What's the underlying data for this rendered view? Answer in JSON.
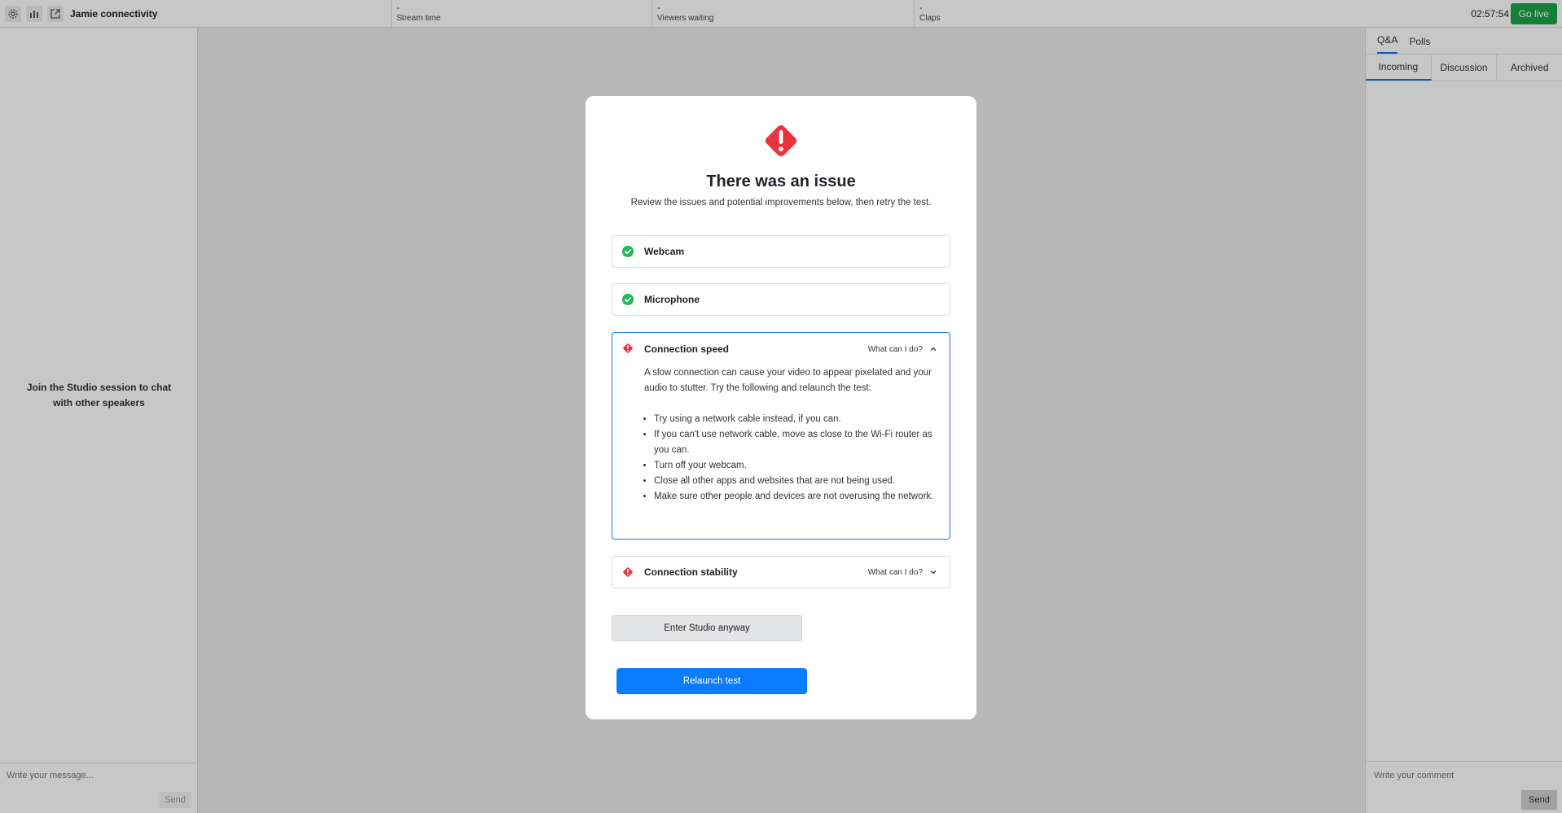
{
  "topbar": {
    "icons": [
      "gear-icon",
      "bar-chart-icon",
      "external-link-icon"
    ],
    "title": "Jamie connectivity",
    "stats": [
      {
        "value": "-",
        "label": "Stream time"
      },
      {
        "value": "-",
        "label": "Viewers waiting"
      },
      {
        "value": "-",
        "label": "Claps"
      }
    ],
    "timer": "02:57:54",
    "go_live_label": "Go live",
    "go_live_color": "#1aa34a"
  },
  "left_chat": {
    "empty_text": "Join the Studio session to chat with other speakers",
    "placeholder": "Write your message...",
    "send_label": "Send"
  },
  "right_panel": {
    "tabs": [
      {
        "label": "Q&A",
        "active": true
      },
      {
        "label": "Polls",
        "active": false
      }
    ],
    "subtabs": [
      {
        "label": "Incoming",
        "active": true
      },
      {
        "label": "Discussion",
        "active": false
      },
      {
        "label": "Archived",
        "active": false
      }
    ],
    "placeholder": "Write your comment",
    "send_label": "Send"
  },
  "modal": {
    "icon": "warning-diamond-icon",
    "title": "There was an issue",
    "subtitle": "Review the issues and potential improvements below, then retry the test.",
    "checks": [
      {
        "name": "Webcam",
        "status": "pass",
        "icon": "check-circle-icon"
      },
      {
        "name": "Microphone",
        "status": "pass",
        "icon": "check-circle-icon"
      },
      {
        "name": "Connection speed",
        "status": "fail",
        "icon": "warning-diamond-icon",
        "help_label": "What can I do?",
        "expanded": true,
        "intro": "A slow connection can cause your video to appear pixelated and your audio to stutter. Try the following and relaunch the test:",
        "tips": [
          "Try using a network cable instead, if you can.",
          "If you can't use network cable, move as close to the Wi-Fi router as you can.",
          "Turn off your webcam.",
          "Close all other apps and websites that are not being used.",
          "Make sure other people and devices are not overusing the network."
        ]
      },
      {
        "name": "Connection stability",
        "status": "fail",
        "icon": "warning-diamond-icon",
        "help_label": "What can I do?",
        "expanded": false
      }
    ],
    "enter_anyway_label": "Enter Studio anyway",
    "relaunch_label": "Relaunch test"
  },
  "colors": {
    "pass": "#1db954",
    "fail": "#e8333c",
    "accent": "#1a73e8",
    "primary_button": "#0a7cff"
  }
}
